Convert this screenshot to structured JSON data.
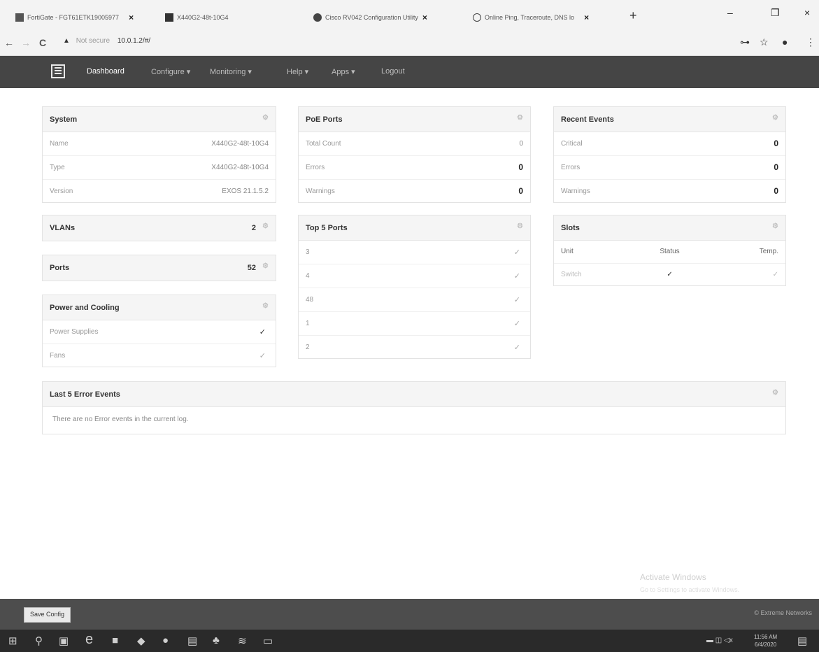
{
  "browser": {
    "tabs": [
      {
        "title": "FortiGate - FGT61ETK19005977",
        "close": "×"
      },
      {
        "title": "X440G2-48t-10G4",
        "close": "×"
      },
      {
        "title": "Cisco RV042 Configuration Utility",
        "close": "×"
      },
      {
        "title": "Online Ping, Traceroute, DNS lo",
        "close": "×"
      }
    ],
    "new_tab": "+",
    "window_controls": [
      "–",
      "❐",
      "×"
    ],
    "nav": {
      "back": "←",
      "forward": "→",
      "reload": "C"
    },
    "address": {
      "warning_icon": "▲",
      "security_text": "Not secure",
      "url": "10.0.1.2/#/"
    },
    "toolbar_icons": {
      "key": "⊶",
      "star": "☆",
      "profile": "●",
      "menu": "⋮"
    }
  },
  "navbar": {
    "items": [
      {
        "label": "Dashboard",
        "active": true
      },
      {
        "label": "Configure ▾",
        "active": false
      },
      {
        "label": "Monitoring ▾",
        "active": false
      },
      {
        "label": "Help ▾",
        "active": false
      },
      {
        "label": "Apps ▾",
        "active": false
      },
      {
        "label": "Logout",
        "active": false
      }
    ]
  },
  "system": {
    "title": "System",
    "rows": [
      {
        "label": "Name",
        "value": "X440G2-48t-10G4"
      },
      {
        "label": "Type",
        "value": "X440G2-48t-10G4"
      },
      {
        "label": "Version",
        "value": "EXOS 21.1.5.2"
      }
    ]
  },
  "vlans": {
    "title": "VLANs",
    "count": "2"
  },
  "ports": {
    "title": "Ports",
    "count": "52"
  },
  "power": {
    "title": "Power and Cooling",
    "rows": [
      {
        "label": "Power Supplies",
        "value": "✓"
      },
      {
        "label": "Fans",
        "value": "✓"
      }
    ]
  },
  "poe": {
    "title": "PoE Ports",
    "rows": [
      {
        "label": "Total Count",
        "value": "0"
      },
      {
        "label": "Errors",
        "value": "0"
      },
      {
        "label": "Warnings",
        "value": "0"
      }
    ]
  },
  "top5": {
    "title": "Top 5 Ports",
    "rows": [
      {
        "label": "3",
        "value": "✓"
      },
      {
        "label": "4",
        "value": "✓"
      },
      {
        "label": "48",
        "value": "✓"
      },
      {
        "label": "1",
        "value": "✓"
      },
      {
        "label": "2",
        "value": "✓"
      }
    ]
  },
  "events": {
    "title": "Recent Events",
    "rows": [
      {
        "label": "Critical",
        "value": "0"
      },
      {
        "label": "Errors",
        "value": "0"
      },
      {
        "label": "Warnings",
        "value": "0"
      }
    ]
  },
  "slots": {
    "title": "Slots",
    "headers": [
      "Unit",
      "Status",
      "Temp."
    ],
    "row": {
      "unit": "Switch",
      "status": "✓",
      "temp": "✓"
    }
  },
  "errors": {
    "title": "Last 5 Error Events",
    "message": "There are no Error events in the current log."
  },
  "watermark": {
    "line1": "Activate Windows",
    "line2": "Go to Settings to activate Windows."
  },
  "footer": {
    "save_label": "Save Config",
    "copyright": "© Extreme Networks"
  },
  "taskbar": {
    "icons": [
      "⊞",
      "⚲",
      "▣",
      "e",
      "■",
      "◆",
      "●",
      "▤",
      "♣",
      "≋",
      "▭"
    ],
    "time": "11:56 AM",
    "date": "6/4/2020"
  }
}
